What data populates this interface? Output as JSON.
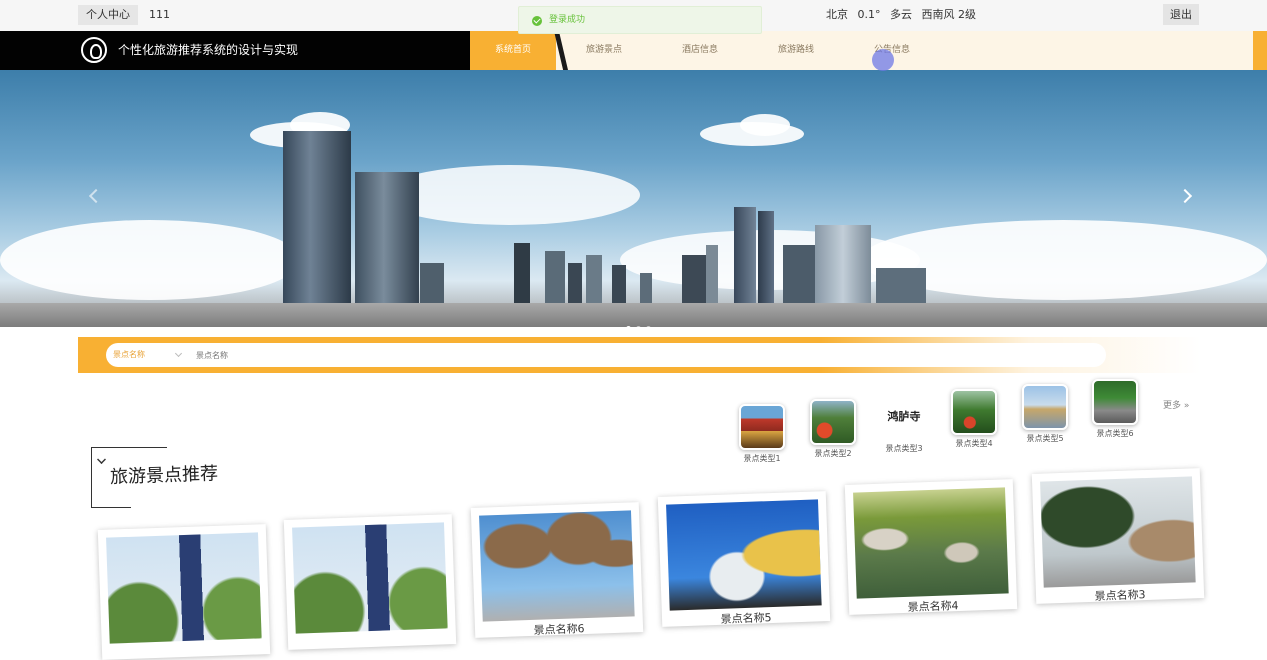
{
  "topbar": {
    "personal_center": "个人中心",
    "username": "111",
    "toast": "登录成功",
    "weather": {
      "city": "北京",
      "temperature": "0.1°",
      "condition": "多云",
      "wind": "西南风 2级"
    },
    "logout": "退出"
  },
  "nav": {
    "site_title": "个性化旅游推荐系统的设计与实现",
    "items": [
      {
        "label": "系统首页",
        "active": true
      },
      {
        "label": "旅游景点",
        "active": false
      },
      {
        "label": "酒店信息",
        "active": false
      },
      {
        "label": "旅游路线",
        "active": false
      },
      {
        "label": "公告信息",
        "active": false
      }
    ]
  },
  "search": {
    "select_value": "景点名称",
    "placeholder": "景点名称"
  },
  "categories": {
    "items": [
      {
        "label": "景点类型1",
        "icon": "pagoda-photo"
      },
      {
        "label": "景点类型2",
        "icon": "garden-photo"
      },
      {
        "label": "景点类型3",
        "icon": "calligraphy-logo",
        "logo_text": "鸿胪寺"
      },
      {
        "label": "景点类型4",
        "icon": "forest-photo"
      },
      {
        "label": "景点类型5",
        "icon": "lake-photo"
      },
      {
        "label": "景点类型6",
        "icon": "temple-photo"
      }
    ],
    "more": "更多"
  },
  "section": {
    "title": "旅游景点推荐"
  },
  "cards": {
    "items": [
      {
        "label": "",
        "photo": "tower-trees"
      },
      {
        "label": "",
        "photo": "tower-trees"
      },
      {
        "label": "景点名称6",
        "photo": "steel-trees"
      },
      {
        "label": "景点名称5",
        "photo": "statue"
      },
      {
        "label": "景点名称4",
        "photo": "river-rocks"
      },
      {
        "label": "景点名称3",
        "photo": "pine-cliff"
      }
    ]
  },
  "colors": {
    "accent": "#f8b033",
    "nav_black": "#020202",
    "toast_green": "#67c23a"
  }
}
